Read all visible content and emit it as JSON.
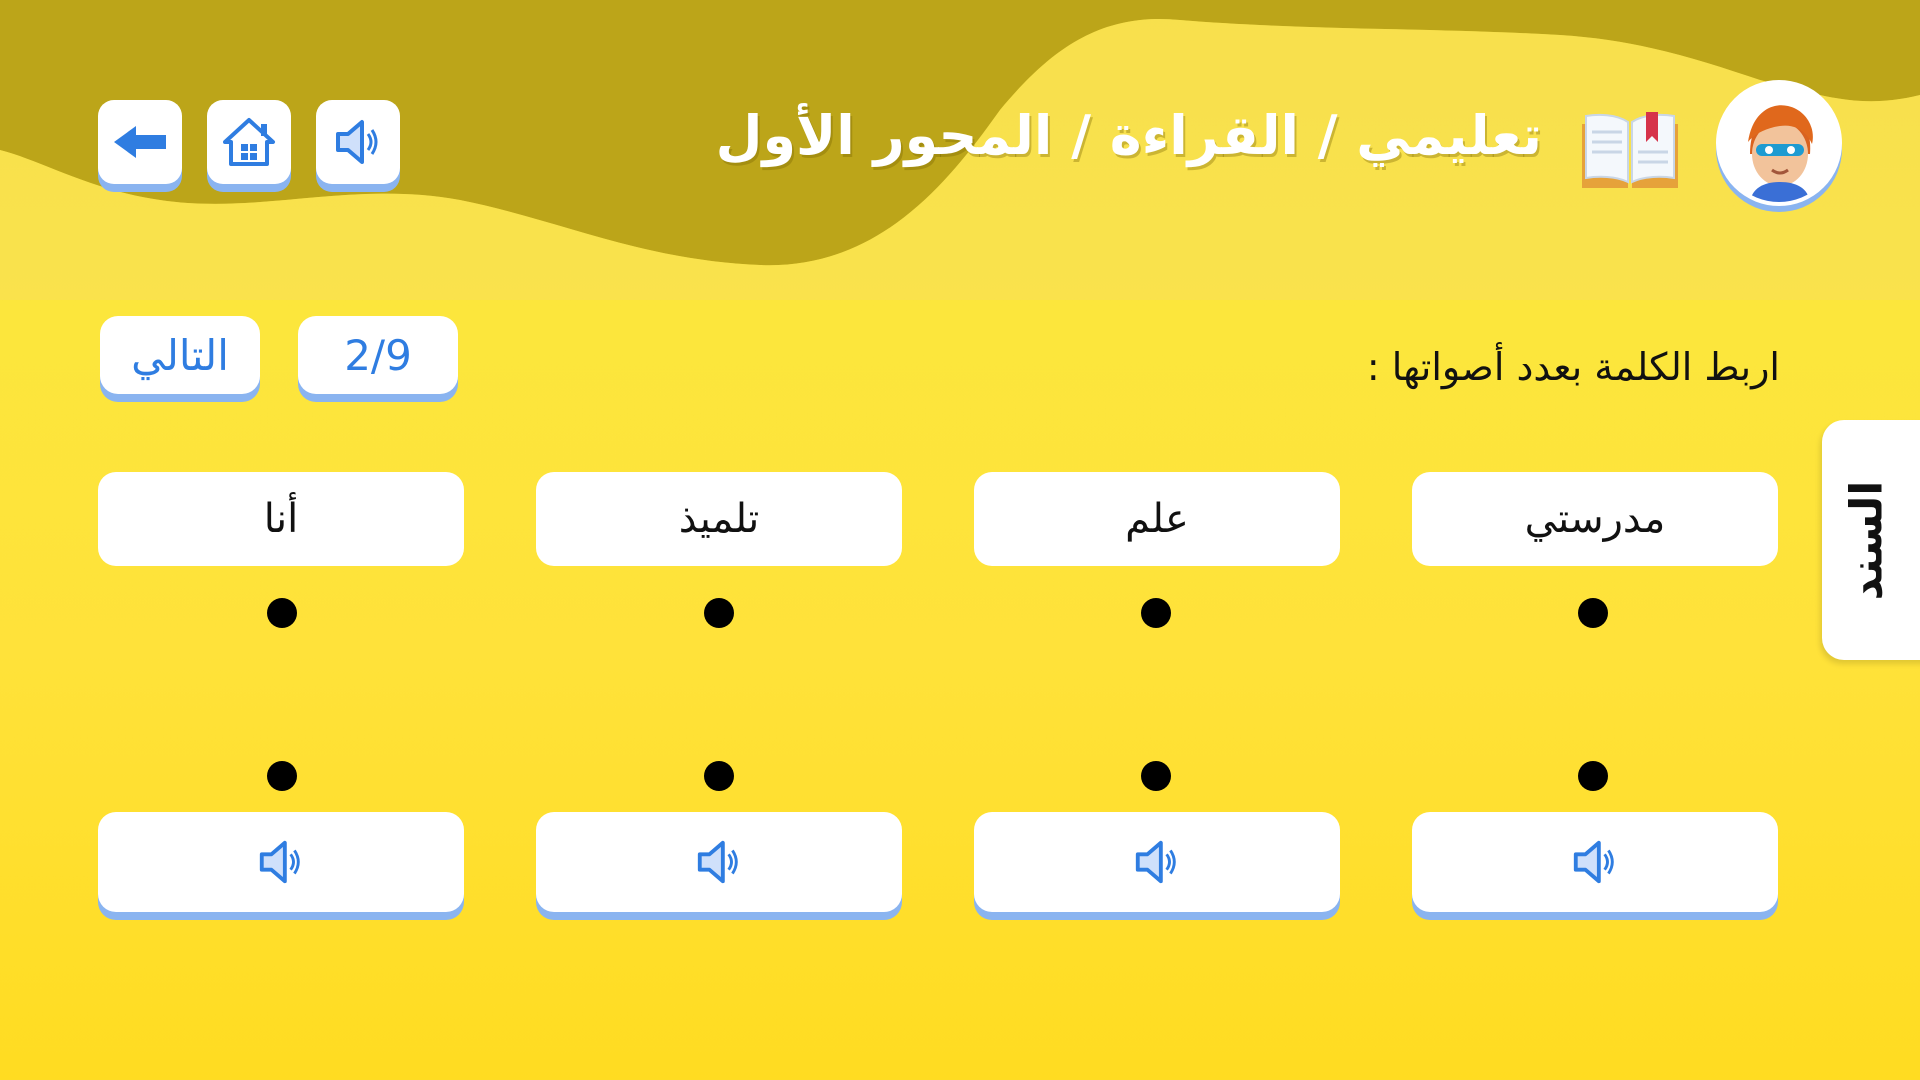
{
  "header": {
    "title": "تعليمي / القراءة / المحور الأول",
    "avatar_icon": "student-avatar-icon",
    "book_icon": "open-book-icon"
  },
  "toolbar": {
    "back_icon": "arrow-left-icon",
    "home_icon": "home-icon",
    "sound_icon": "speaker-icon"
  },
  "exercise": {
    "instruction": "اربط الكلمة بعدد أصواتها :",
    "next_label": "التالي",
    "progress": "2/9",
    "side_tab_label": "السند",
    "words": [
      "مدرستي",
      "علم",
      "تلميذ",
      "أنا"
    ],
    "audio_icon": "speaker-icon"
  },
  "colors": {
    "background": "#ffe23a",
    "accent_blue": "#2f7de1",
    "button_shadow": "#8ab4f0"
  }
}
